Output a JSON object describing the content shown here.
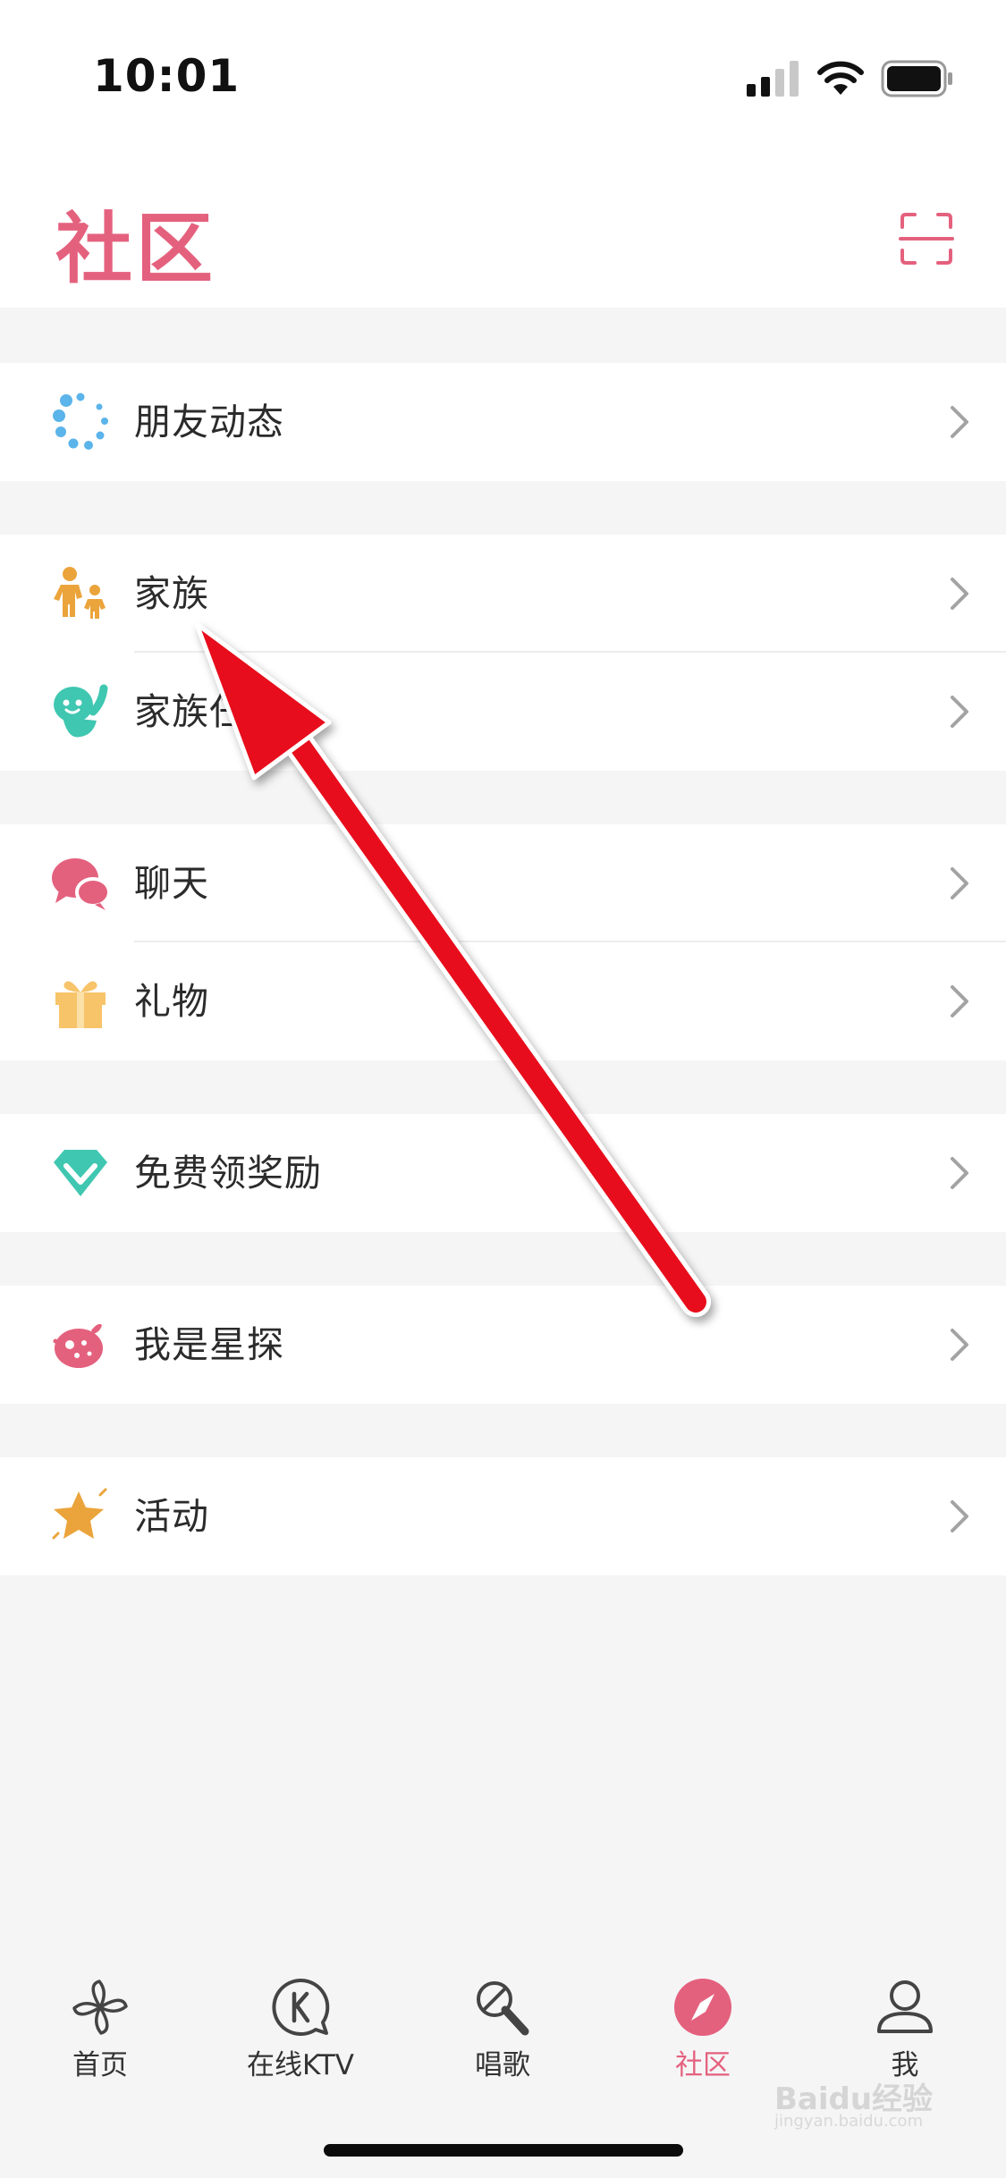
{
  "status_bar": {
    "time": "10:01"
  },
  "header": {
    "title": "社区"
  },
  "menu": {
    "friends_feed": "朋友动态",
    "family": "家族",
    "family_ranking": "家族任",
    "chat": "聊天",
    "gifts": "礼物",
    "free_rewards": "免费领奖励",
    "talent_scout": "我是星探",
    "activities": "活动"
  },
  "tabbar": {
    "home": "首页",
    "ktv": "在线KTV",
    "sing": "唱歌",
    "community": "社区",
    "me": "我"
  },
  "watermark": {
    "brand": "Baidu经验",
    "site": "jingyan.baidu.com"
  },
  "colors": {
    "accent": "#e4617e",
    "annotation": "#e8101a"
  }
}
